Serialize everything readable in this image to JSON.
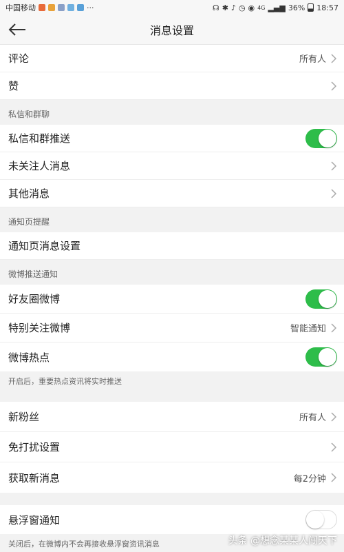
{
  "status_bar": {
    "carrier": "中国移动",
    "more": "···",
    "network": "4G",
    "battery": "36%",
    "time": "18:57"
  },
  "header": {
    "title": "消息设置"
  },
  "colors": {
    "toggle_on": "#2ebd4a",
    "background": "#f2f2f2"
  },
  "rows": {
    "comment": {
      "label": "评论",
      "value": "所有人"
    },
    "like": {
      "label": "赞"
    },
    "dm_push": {
      "label": "私信和群推送",
      "toggle": true
    },
    "unfollowed_msgs": {
      "label": "未关注人消息"
    },
    "other_msgs": {
      "label": "其他消息"
    },
    "notification_page_settings": {
      "label": "通知页消息设置"
    },
    "friends_weibo": {
      "label": "好友圈微博",
      "toggle": true
    },
    "special_follow": {
      "label": "特别关注微博",
      "value": "智能通知"
    },
    "hot_topics": {
      "label": "微博热点",
      "toggle": true
    },
    "new_fans": {
      "label": "新粉丝",
      "value": "所有人"
    },
    "dnd": {
      "label": "免打扰设置"
    },
    "fetch_new": {
      "label": "获取新消息",
      "value": "每2分钟"
    },
    "floating_window": {
      "label": "悬浮窗通知",
      "toggle": false
    }
  },
  "sections": {
    "dm": "私信和群聊",
    "notification_page": "通知页提醒",
    "weibo_push": "微博推送通知"
  },
  "notes": {
    "hot_topics": "开启后，重要热点资讯将实时推送",
    "floating_window": "关闭后，在微博内不会再接收悬浮窗资讯消息"
  },
  "watermark": "头条 @想念某某人闯天下"
}
